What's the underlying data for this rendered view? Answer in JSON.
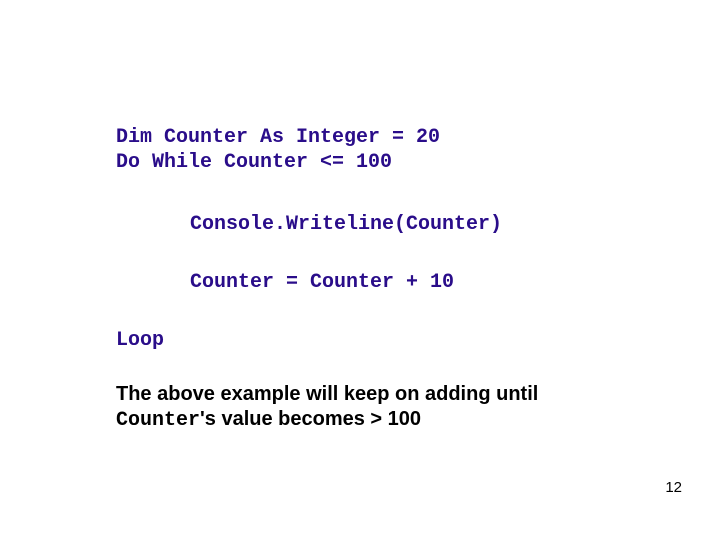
{
  "code": {
    "line1": "Dim Counter As Integer = 20",
    "line2": "Do While Counter <= 100",
    "console": "Console.Writeline(Counter)",
    "increment": "Counter = Counter + 10",
    "loop": "Loop"
  },
  "explanation": {
    "part1": "The above example will keep on adding until ",
    "mono": "Counter",
    "part2": "'s value becomes > 100"
  },
  "page_number": "12"
}
